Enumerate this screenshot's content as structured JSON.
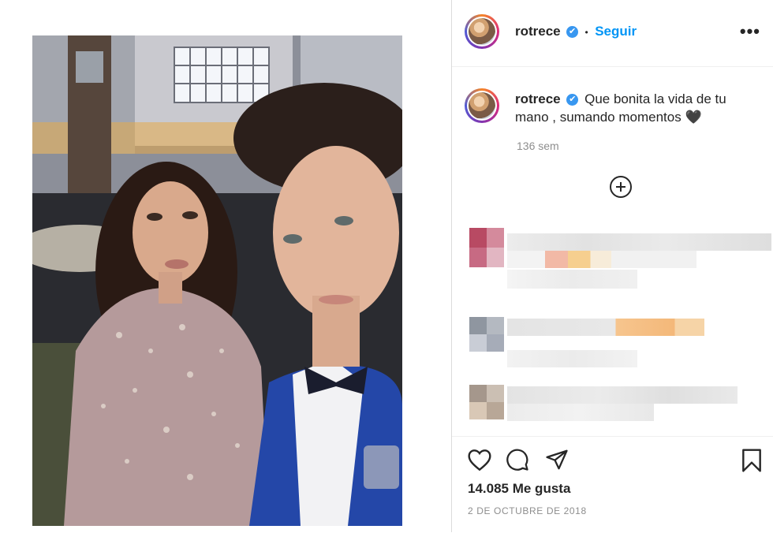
{
  "post": {
    "username": "rotrece",
    "verified_symbol": "✔",
    "separator": "•",
    "follow_label": "Seguir",
    "more_label": "•••",
    "caption_text": "Que bonita la vida de tu mano , sumando momentos 🖤",
    "time_ago": "136 sem",
    "likes": "14.085 Me gusta",
    "date": "2 DE OCTUBRE DE 2018"
  },
  "icons": {
    "more": "more-options-icon",
    "load_more": "plus-circle-icon",
    "like": "heart-icon",
    "comment": "comment-bubble-icon",
    "share": "paper-plane-icon",
    "save": "bookmark-icon"
  },
  "colors": {
    "verified": "#3897f0",
    "follow": "#0095f6",
    "muted": "#8e8e8e",
    "text": "#262626"
  }
}
